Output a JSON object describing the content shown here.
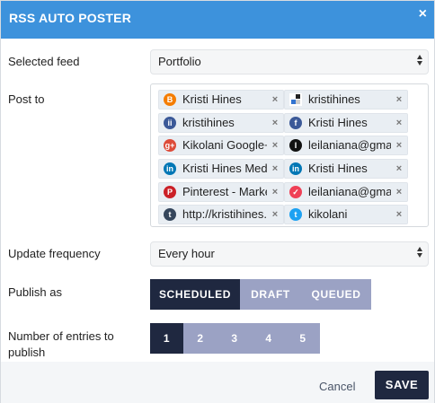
{
  "header": {
    "title": "RSS AUTO POSTER",
    "close_glyph": "×"
  },
  "selected_feed": {
    "label": "Selected feed",
    "value": "Portfolio"
  },
  "post_to": {
    "label": "Post to",
    "accounts": [
      {
        "name": "Kristi Hines",
        "icon": "blogger-icon",
        "color": "#f57d00",
        "glyph": "B"
      },
      {
        "name": "kristihines",
        "icon": "delicious-icon",
        "color": "#ffffff",
        "glyph": ""
      },
      {
        "name": "kristihines",
        "icon": "instapaper-icon",
        "color": "#3b5998",
        "glyph": "ii"
      },
      {
        "name": "Kristi Hines",
        "icon": "facebook-icon",
        "color": "#3b5998",
        "glyph": "f"
      },
      {
        "name": "Kikolani Google+",
        "icon": "google-plus-icon",
        "color": "#dd4b39",
        "glyph": "g+"
      },
      {
        "name": "leilaniana@gmail.com",
        "icon": "instapaper-dark-icon",
        "color": "#111111",
        "glyph": "I"
      },
      {
        "name": "Kristi Hines Media",
        "icon": "linkedin-icon",
        "color": "#0077b5",
        "glyph": "in"
      },
      {
        "name": "Kristi Hines",
        "icon": "linkedin-icon",
        "color": "#0077b5",
        "glyph": "in"
      },
      {
        "name": "Pinterest - Marketing",
        "icon": "pinterest-icon",
        "color": "#cb2027",
        "glyph": "P"
      },
      {
        "name": "leilaniana@gmail.com",
        "icon": "pocket-icon",
        "color": "#ef4056",
        "glyph": "✓"
      },
      {
        "name": "http://kristihines.tumblr.com",
        "icon": "tumblr-icon",
        "color": "#35465c",
        "glyph": "t"
      },
      {
        "name": "kikolani",
        "icon": "twitter-icon",
        "color": "#1da1f2",
        "glyph": "t"
      }
    ],
    "remove_glyph": "×"
  },
  "update_frequency": {
    "label": "Update frequency",
    "value": "Every hour"
  },
  "publish_as": {
    "label": "Publish as",
    "options": [
      "SCHEDULED",
      "DRAFT",
      "QUEUED"
    ],
    "selected": "SCHEDULED"
  },
  "entries": {
    "label_line1": "Number of entries to",
    "label_line2": "publish",
    "options": [
      "1",
      "2",
      "3",
      "4",
      "5"
    ],
    "selected": "1"
  },
  "footer": {
    "cancel_label": "Cancel",
    "save_label": "SAVE"
  },
  "colors": {
    "header": "#3d92dc",
    "dark": "#1f2840",
    "segment": "#9ba2c4"
  }
}
